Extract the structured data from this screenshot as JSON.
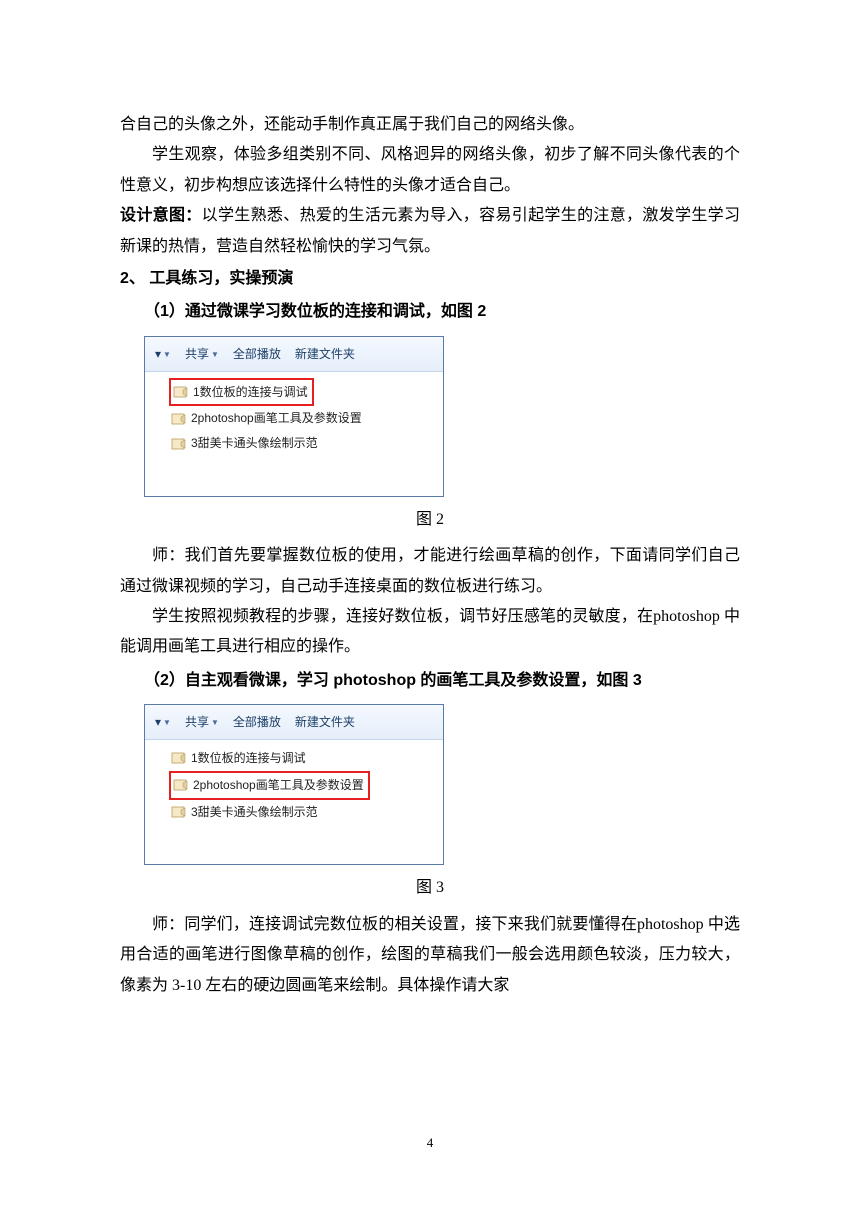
{
  "paragraphs": {
    "p1": "合自己的头像之外，还能动手制作真正属于我们自己的网络头像。",
    "p2": "学生观察，体验多组类别不同、风格迥异的网络头像，初步了解不同头像代表的个性意义，初步构想应该选择什么特性的头像才适合自己。",
    "design_label": "设计意图：",
    "p3": "以学生熟悉、热爱的生活元素为导入，容易引起学生的注意，激发学生学习新课的热情，营造自然轻松愉快的学习气氛。",
    "h2": "2、 工具练习，实操预演",
    "sub1": "（1）通过微课学习数位板的连接和调试，如图 2",
    "cap2": "图 2",
    "p4": "师：我们首先要掌握数位板的使用，才能进行绘画草稿的创作，下面请同学们自己通过微课视频的学习，自己动手连接桌面的数位板进行练习。",
    "p5": "学生按照视频教程的步骤，连接好数位板，调节好压感笔的灵敏度，在photoshop 中能调用画笔工具进行相应的操作。",
    "sub2": "（2）自主观看微课，学习 photoshop 的画笔工具及参数设置，如图 3",
    "cap3": "图 3",
    "p6": "师：同学们，连接调试完数位板的相关设置，接下来我们就要懂得在photoshop 中选用合适的画笔进行图像草稿的创作，绘图的草稿我们一般会选用颜色较淡，压力较大，像素为 3-10 左右的硬边圆画笔来绘制。具体操作请大家"
  },
  "toolbar": {
    "share": "共享",
    "playall": "全部播放",
    "newfolder": "新建文件夹"
  },
  "files": {
    "f1": "1数位板的连接与调试",
    "f2": "2photoshop画笔工具及参数设置",
    "f3": "3甜美卡通头像绘制示范"
  },
  "page_number": "4"
}
